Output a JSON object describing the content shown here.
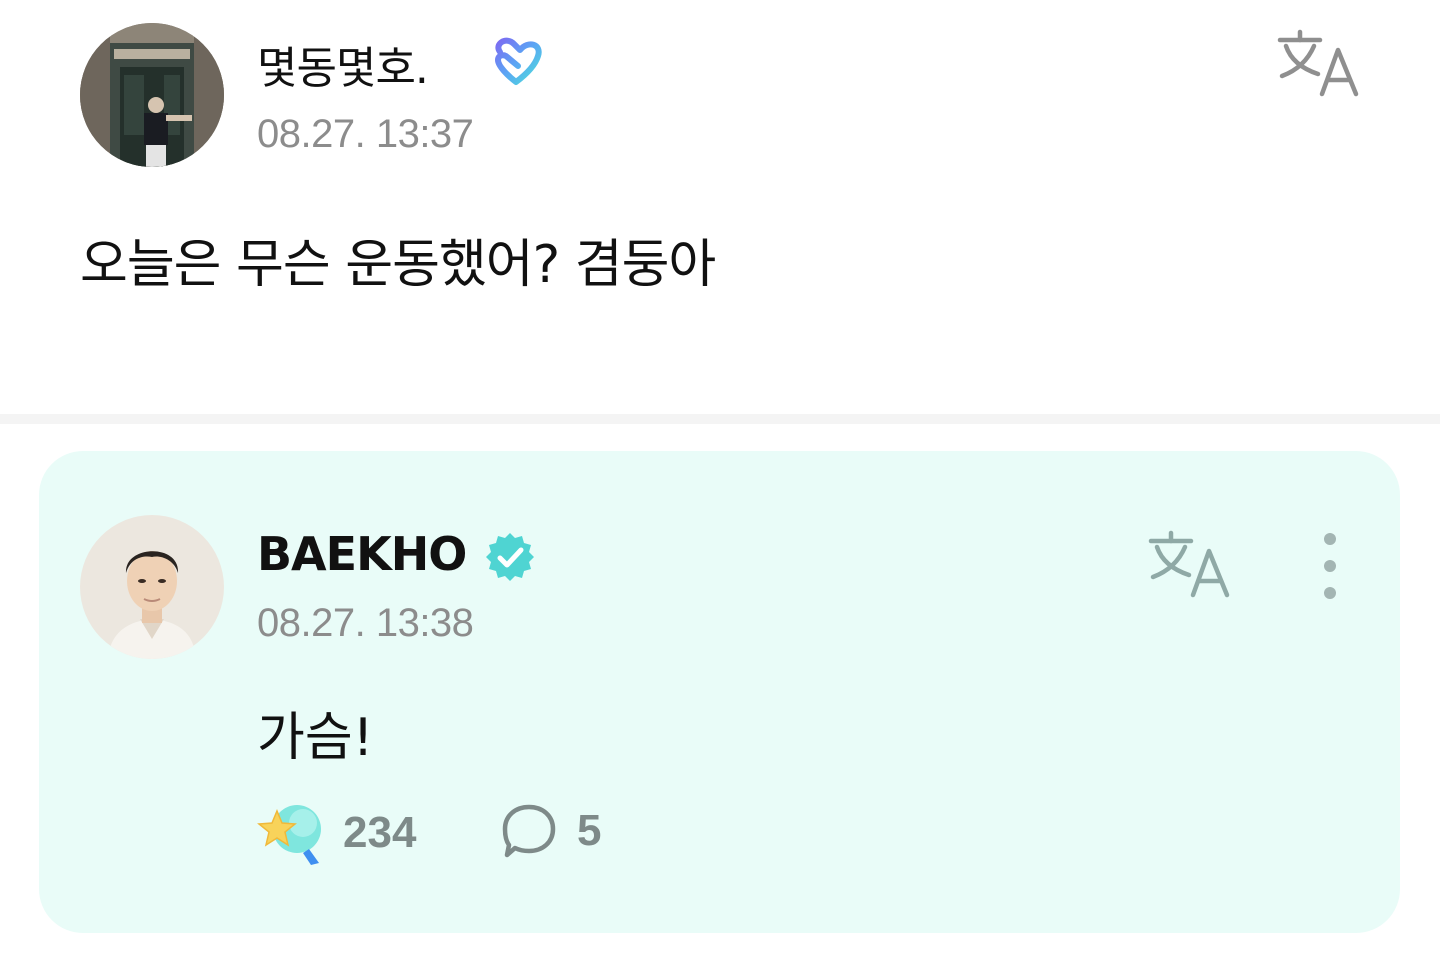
{
  "post": {
    "author": "몇동몇호.",
    "timestamp": "08.27. 13:37",
    "body": "오늘은 무슨 운동했어? 겸둥아",
    "translate_icon": "translate-icon"
  },
  "reply": {
    "author": "BAEKHO",
    "timestamp": "08.27. 13:38",
    "body": "가슴!",
    "reaction_count": "234",
    "comment_count": "5",
    "translate_icon": "translate-icon",
    "more_icon": "more-vertical-icon"
  },
  "colors": {
    "card_bg": "#e9fcf8",
    "verified": "#4fd4d2",
    "muted": "#8c8c8c",
    "icon_gray": "#a3b5b3"
  }
}
